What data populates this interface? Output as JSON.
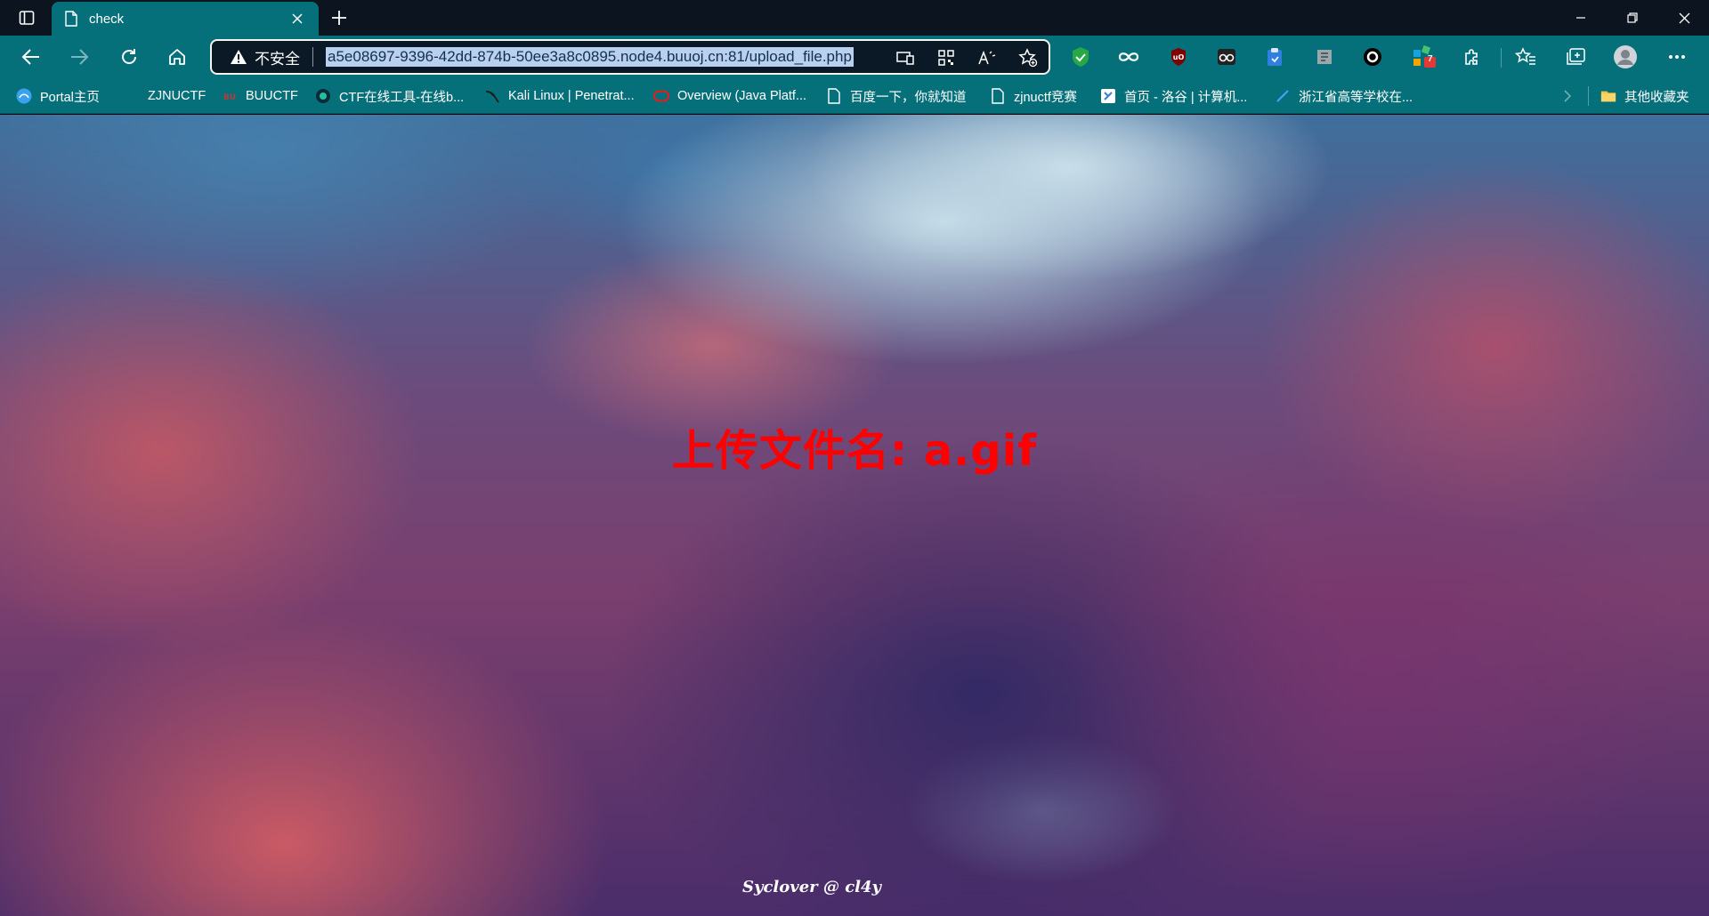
{
  "browser": {
    "tab": {
      "title": "check"
    },
    "address_bar": {
      "security_label": "不安全",
      "url": "a5e08697-9396-42dd-874b-50ee3a8c0895.node4.buuoj.cn:81/upload_file.php"
    },
    "extensions": {
      "badge_count": "7"
    },
    "bookmarks": [
      {
        "label": "Portal主页",
        "icon": "portal-icon"
      },
      {
        "label": "ZJNUCTF",
        "icon": ""
      },
      {
        "label": "BUUCTF",
        "icon": "buuctf-icon"
      },
      {
        "label": "CTF在线工具-在线b...",
        "icon": "ctf-tools-icon"
      },
      {
        "label": "Kali Linux | Penetrat...",
        "icon": "kali-icon"
      },
      {
        "label": "Overview (Java Platf...",
        "icon": "oracle-icon"
      },
      {
        "label": "百度一下，你就知道",
        "icon": "page-icon"
      },
      {
        "label": "zjnuctf竞赛",
        "icon": "page-icon"
      },
      {
        "label": "首页 - 洛谷 | 计算机...",
        "icon": "luogu-icon"
      },
      {
        "label": "浙江省高等学校在...",
        "icon": "zj-icon"
      }
    ],
    "other_bookmarks": "其他收藏夹",
    "colors": {
      "theme": "#06707a",
      "titlebar": "#0c1420"
    }
  },
  "page": {
    "upload_message": "上传文件名: a.gif",
    "footer": "Syclover @ cl4y",
    "colors": {
      "message": "#ff0000"
    }
  }
}
